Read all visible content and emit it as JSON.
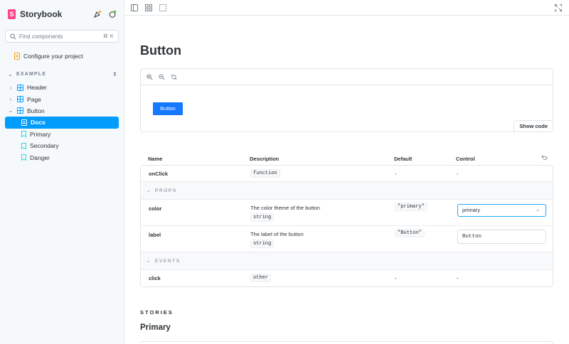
{
  "sidebar": {
    "brand": "Storybook",
    "search_placeholder": "Find components",
    "search_shortcut": "⌘ K",
    "configure_label": "Configure your project",
    "section_title": "EXAMPLE",
    "items": [
      {
        "label": "Header",
        "icon": "component-icon"
      },
      {
        "label": "Page",
        "icon": "component-icon"
      },
      {
        "label": "Button",
        "icon": "component-icon"
      },
      {
        "label": "Docs",
        "icon": "document-icon",
        "active": true
      },
      {
        "label": "Primary",
        "icon": "bookmark-icon"
      },
      {
        "label": "Secondary",
        "icon": "bookmark-icon"
      },
      {
        "label": "Danger",
        "icon": "bookmark-icon"
      }
    ]
  },
  "docs": {
    "title": "Button",
    "demo_button": "Button",
    "show_code": "Show code",
    "columns": {
      "name": "Name",
      "description": "Description",
      "default": "Default",
      "control": "Control"
    },
    "rows": {
      "onclick": {
        "name": "onClick",
        "type": "function",
        "default": "-",
        "control": "-"
      },
      "props_section": "PROPS",
      "color": {
        "name": "color",
        "description": "The color theme of the button",
        "type": "string",
        "default": "\"primary\"",
        "control": "primary"
      },
      "label": {
        "name": "label",
        "description": "The label of the button",
        "type": "string",
        "default": "\"Button\"",
        "control": "Button"
      },
      "events_section": "EVENTS",
      "click": {
        "name": "click",
        "type": "other",
        "default": "-",
        "control": "-"
      }
    },
    "stories_label": "STORIES",
    "story_title": "Primary"
  },
  "colors": {
    "accent": "#029cfd",
    "brand": "#ff4785",
    "demo_button": "#1677ff"
  }
}
